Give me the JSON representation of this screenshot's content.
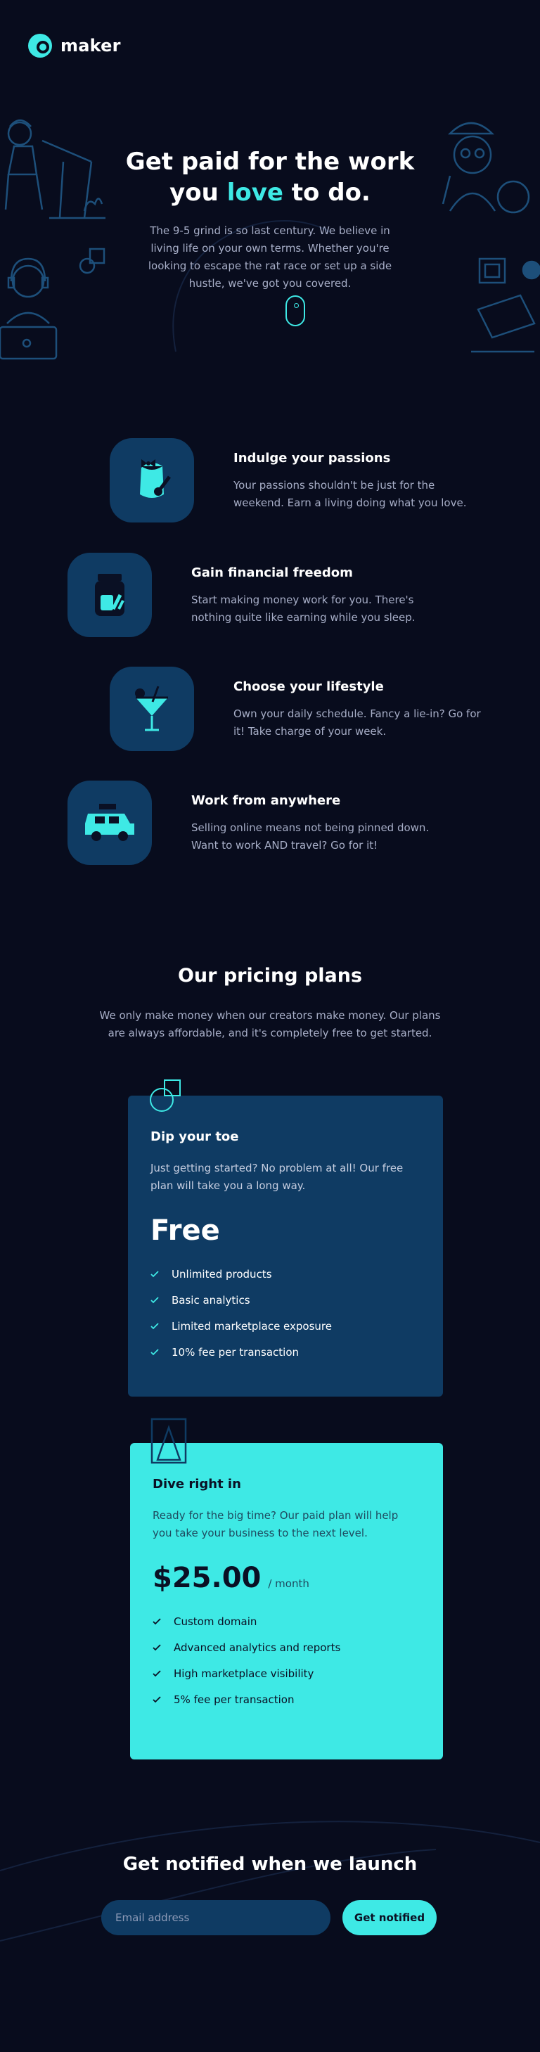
{
  "header": {
    "logo_text": "maker"
  },
  "hero": {
    "title_line1": "Get paid for the work",
    "title_prefix": "you ",
    "title_highlight": "love",
    "title_suffix": " to do.",
    "text": "The 9-5 grind is so last century. We believe in living life on your own terms. Whether you're looking to escape the rat race or set up a side hustle, we've got you covered."
  },
  "features": [
    {
      "title": "Indulge your passions",
      "text": "Your passions shouldn't be just for the weekend. Earn a living doing what you love.",
      "icon": "paint-bucket-icon"
    },
    {
      "title": "Gain financial freedom",
      "text": "Start making money work for you. There's nothing quite like earning while you sleep.",
      "icon": "money-jar-icon"
    },
    {
      "title": "Choose your lifestyle",
      "text": "Own your daily schedule. Fancy a lie-in? Go for it! Take charge of your week.",
      "icon": "cocktail-icon"
    },
    {
      "title": "Work from anywhere",
      "text": "Selling online means not being pinned down. Want to work AND travel? Go for it!",
      "icon": "car-icon"
    }
  ],
  "pricing": {
    "title": "Our pricing plans",
    "text": "We only make money when our creators make money. Our plans are always affordable, and it's completely free to get started.",
    "plans": [
      {
        "name": "Dip your toe",
        "desc": "Just getting started? No problem at all! Our free plan will take you a long way.",
        "price": "Free",
        "features": [
          "Unlimited products",
          "Basic analytics",
          "Limited marketplace exposure",
          "10% fee per transaction"
        ]
      },
      {
        "name": "Dive right in",
        "desc": "Ready for the big time? Our paid plan will help you take your business to the next level.",
        "price": "$25.00",
        "per": "/ month",
        "features": [
          "Custom domain",
          "Advanced analytics and reports",
          "High marketplace visibility",
          "5% fee per transaction"
        ]
      }
    ]
  },
  "notify": {
    "title": "Get notified when we launch",
    "placeholder": "Email address",
    "button": "Get notified"
  },
  "colors": {
    "background": "#080c1d",
    "accent": "#3ee9e5",
    "card": "#0f3b63",
    "muted": "#a7aec7"
  }
}
